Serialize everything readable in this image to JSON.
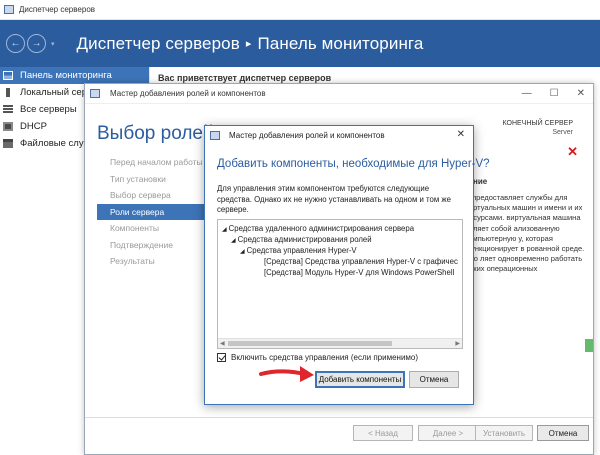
{
  "server_manager": {
    "window_title": "Диспетчер серверов",
    "breadcrumb_app": "Диспетчер серверов",
    "breadcrumb_separator": "▸",
    "breadcrumb_page": "Панель мониторинга",
    "nav_back": "←",
    "nav_forward": "→",
    "nav_dropdown": "▾",
    "sidebar": {
      "items": [
        {
          "label": "Панель мониторинга",
          "icon": "dashboard-icon",
          "active": true
        },
        {
          "label": "Локальный сервер",
          "icon": "local-server-icon",
          "active": false
        },
        {
          "label": "Все серверы",
          "icon": "all-servers-icon",
          "active": false
        },
        {
          "label": "DHCP",
          "icon": "dhcp-icon",
          "active": false
        },
        {
          "label": "Файловые службы",
          "icon": "file-services-icon",
          "active": false
        }
      ]
    },
    "welcome_text": "Вас приветствует диспетчер серверов"
  },
  "wizard": {
    "title": "Мастер добавления ролей и компонентов",
    "heading": "Выбор ролей сервера",
    "destination_label": "КОНЕЧНЫЙ СЕРВЕР",
    "destination_value": "Server",
    "steps": [
      {
        "label": "Перед началом работы",
        "active": false
      },
      {
        "label": "Тип установки",
        "active": false
      },
      {
        "label": "Выбор сервера",
        "active": false
      },
      {
        "label": "Роли сервера",
        "active": true
      },
      {
        "label": "Компоненты",
        "active": false
      },
      {
        "label": "Подтверждение",
        "active": false
      },
      {
        "label": "Результаты",
        "active": false
      }
    ],
    "description_heading": "ние",
    "description_text": "V предоставляет службы для виртуальных машин и имени и их ресурсами. виртуальная машина авляет собой ализованную компьютерную у, которая функционирует в рованной среде. Это ляет одновременно работать льких операционных",
    "buttons": {
      "back": "< Назад",
      "next": "Далее >",
      "install": "Установить",
      "cancel": "Отмена"
    },
    "window_controls": {
      "minimize": "—",
      "maximize": "☐",
      "close": "✕"
    },
    "error_mark": "✕"
  },
  "dialog": {
    "title": "Мастер добавления ролей и компонентов",
    "close": "✕",
    "heading": "Добавить компоненты, необходимые для Hyper-V?",
    "description": "Для управления этим компонентом требуются следующие средства. Однако их не нужно устанавливать на одном и том же сервере.",
    "tree": [
      {
        "label": "Средства удаленного администрирования сервера",
        "level": 0,
        "arrow": "◢"
      },
      {
        "label": "Средства администрирования ролей",
        "level": 1,
        "arrow": "◢"
      },
      {
        "label": "Средства управления Hyper-V",
        "level": 2,
        "arrow": "◢"
      },
      {
        "label": "[Средства] Средства управления Hyper-V с графичес",
        "level": 3,
        "arrow": ""
      },
      {
        "label": "[Средства] Модуль Hyper-V для Windows PowerShell",
        "level": 3,
        "arrow": ""
      }
    ],
    "checkbox_label": "Включить средства управления (если применимо)",
    "checkbox_checked": true,
    "add_button": "Добавить компоненты",
    "cancel_button": "Отмена"
  },
  "annotation": {
    "arrow_color": "#e0262d"
  }
}
